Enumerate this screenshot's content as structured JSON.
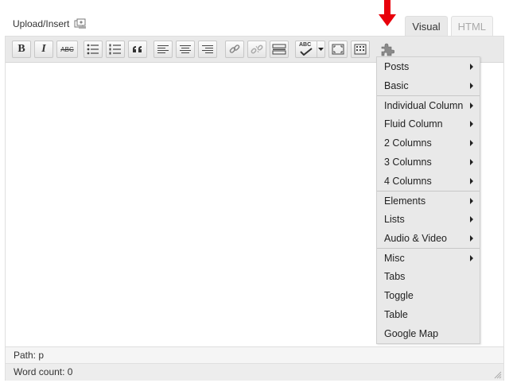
{
  "upload": {
    "label": "Upload/Insert"
  },
  "tabs": [
    {
      "label": "Visual",
      "active": true
    },
    {
      "label": "HTML",
      "active": false
    }
  ],
  "toolbar": {
    "bold": "B",
    "italic": "I",
    "strike": "ABC",
    "spell": "ABC"
  },
  "menu": {
    "items": [
      {
        "label": "Posts",
        "submenu": true
      },
      {
        "label": "Basic",
        "submenu": true
      },
      {
        "label": "Individual Column",
        "submenu": true
      },
      {
        "label": "Fluid Column",
        "submenu": true
      },
      {
        "label": "2 Columns",
        "submenu": true
      },
      {
        "label": "3 Columns",
        "submenu": true
      },
      {
        "label": "4 Columns",
        "submenu": true
      },
      {
        "label": "Elements",
        "submenu": true
      },
      {
        "label": "Lists",
        "submenu": true
      },
      {
        "label": "Audio & Video",
        "submenu": true
      },
      {
        "label": "Misc",
        "submenu": true
      },
      {
        "label": "Tabs",
        "submenu": false
      },
      {
        "label": "Toggle",
        "submenu": false
      },
      {
        "label": "Table",
        "submenu": false
      },
      {
        "label": "Google Map",
        "submenu": false
      }
    ]
  },
  "status": {
    "path": "Path: p",
    "word_count": "Word count: 0"
  },
  "colors": {
    "arrow": "#e8000b",
    "toolbar_bg": "#e9e9e9",
    "menu_bg": "#e9e9e9"
  }
}
